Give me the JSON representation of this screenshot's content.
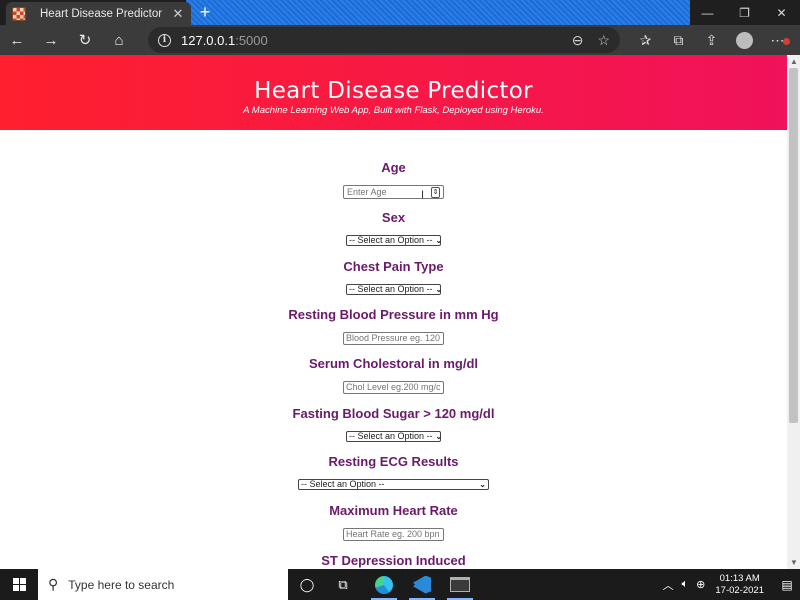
{
  "browser": {
    "tab_title": "Heart Disease Predictor",
    "tab_close": "✕",
    "new_tab": "+",
    "url_host": "127.0.0.1",
    "url_port": ":5000"
  },
  "page": {
    "title": "Heart Disease Predictor",
    "subtitle": "A Machine Learning Web App, Built with Flask, Deployed using Heroku.",
    "header_gradient": [
      "#ff1f2e",
      "#f0125a"
    ],
    "label_color": "#6b1a6b"
  },
  "form": {
    "age": {
      "label": "Age",
      "placeholder": "Enter Age"
    },
    "sex": {
      "label": "Sex",
      "selected": "-- Select an Option --"
    },
    "chest_pain": {
      "label": "Chest Pain Type",
      "selected": "-- Select an Option --"
    },
    "blood_pressure": {
      "label": "Resting Blood Pressure in mm Hg",
      "placeholder": "Blood Pressure eg. 120"
    },
    "cholesterol": {
      "label": "Serum Cholestoral in mg/dl",
      "placeholder": "Chol Level eg.200 mg/c"
    },
    "blood_sugar": {
      "label": "Fasting Blood Sugar > 120 mg/dl",
      "selected": "-- Select an Option --"
    },
    "ecg": {
      "label": "Resting ECG Results",
      "selected": "-- Select an Option --"
    },
    "heart_rate": {
      "label": "Maximum Heart Rate",
      "placeholder": "Heart Rate eg. 200 bpn"
    },
    "st_depression": {
      "label": "ST Depression Induced"
    }
  },
  "taskbar": {
    "search_placeholder": "Type here to search",
    "time": "01:13 AM",
    "date": "17-02-2021"
  }
}
